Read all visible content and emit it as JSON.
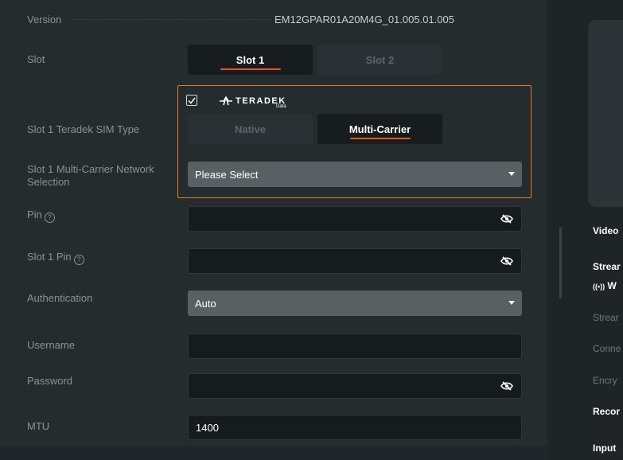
{
  "version": {
    "label": "Version",
    "value": "EM12GPAR01A20M4G_01.005.01.005"
  },
  "slot": {
    "label": "Slot",
    "options": [
      "Slot 1",
      "Slot 2"
    ],
    "selected": "Slot 1"
  },
  "teradek": {
    "logo_text": "TERADEK",
    "logo_sub": "Data",
    "checked": true
  },
  "sim_type": {
    "label": "Slot 1 Teradek SIM Type",
    "options": [
      "Native",
      "Multi-Carrier"
    ],
    "selected": "Multi-Carrier"
  },
  "network": {
    "label": "Slot 1 Multi-Carrier Network Selection",
    "value": "Please Select"
  },
  "pin": {
    "label": "Pin",
    "value": ""
  },
  "slot_pin": {
    "label": "Slot 1 Pin",
    "value": ""
  },
  "authentication": {
    "label": "Authentication",
    "value": "Auto"
  },
  "username": {
    "label": "Username",
    "value": ""
  },
  "password": {
    "label": "Password",
    "value": ""
  },
  "mtu": {
    "label": "MTU",
    "value": "1400"
  },
  "right_panel": {
    "video": "Video",
    "stream_heading": "Strear",
    "stream_status": "W",
    "stream_row": "Strear",
    "connection_row": "Conne",
    "encryption_row": "Encry",
    "record": "Recor",
    "input": "Input"
  },
  "colors": {
    "accent": "#e8792a",
    "underline": "#e8541e",
    "panel": "#252c2e",
    "select": "#596064"
  }
}
